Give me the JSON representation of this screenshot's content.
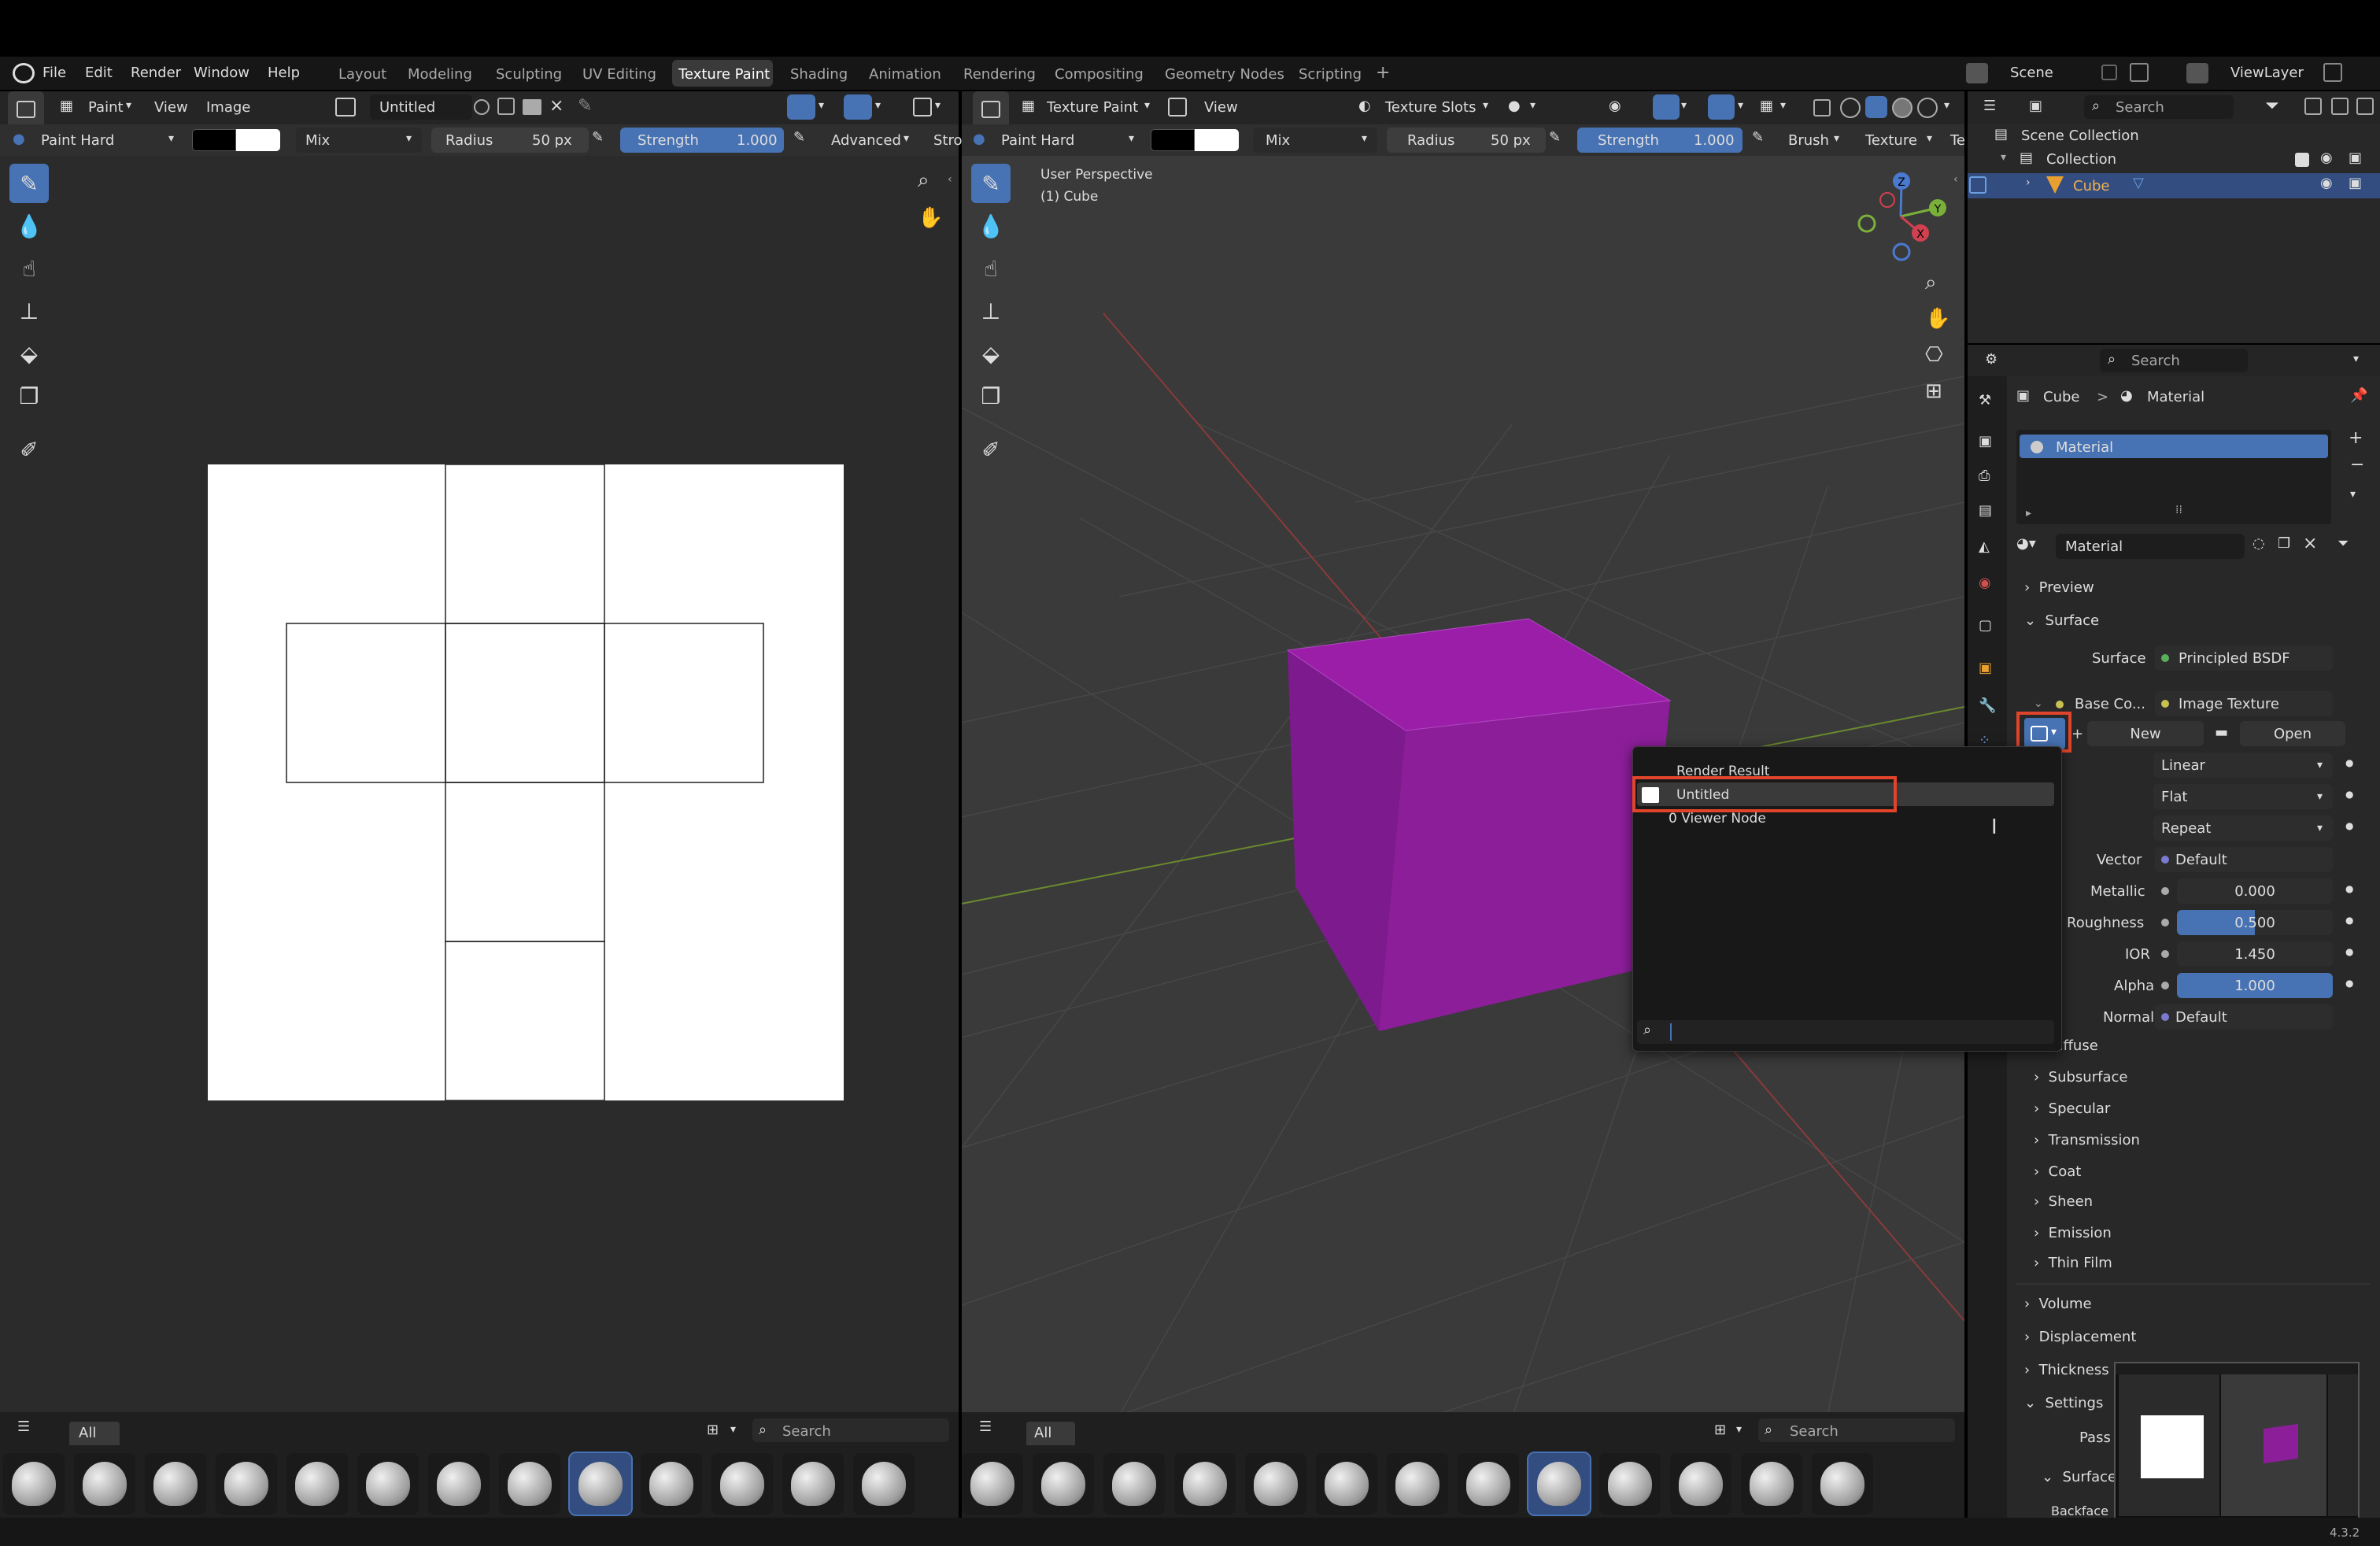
{
  "menu": {
    "items": [
      "File",
      "Edit",
      "Render",
      "Window",
      "Help"
    ],
    "workspaces": [
      "Layout",
      "Modeling",
      "Sculpting",
      "UV Editing",
      "Texture Paint",
      "Shading",
      "Animation",
      "Rendering",
      "Compositing",
      "Geometry Nodes",
      "Scripting"
    ],
    "active_workspace": "Texture Paint",
    "add_tab": "+",
    "scene": "Scene",
    "view_layer": "ViewLayer"
  },
  "image_editor": {
    "mode": "Paint",
    "view": "View",
    "image_menu": "Image",
    "image_name": "Untitled",
    "brush": "Paint Hard",
    "blend": "Mix",
    "radius_label": "Radius",
    "radius_value": "50 px",
    "strength_label": "Strength",
    "strength_value": "1.000",
    "advanced": "Advanced",
    "truncated": "Stro",
    "filter_all": "All",
    "search_placeholder": "Search"
  },
  "viewport": {
    "mode": "Texture Paint",
    "view": "View",
    "texture_slots": "Texture Slots",
    "brush": "Paint Hard",
    "blend": "Mix",
    "radius_label": "Radius",
    "radius_value": "50 px",
    "strength_label": "Strength",
    "strength_value": "1.000",
    "brush_menu": "Brush",
    "texture_menu": "Texture",
    "truncated": "Te",
    "perspective": "User Perspective",
    "object": "(1) Cube",
    "gizmo": {
      "z": "Z",
      "y": "Y",
      "x": "X"
    },
    "filter_all": "All",
    "search_placeholder": "Search"
  },
  "outliner": {
    "search_placeholder": "Search",
    "scene_collection": "Scene Collection",
    "collection": "Collection",
    "cube": "Cube"
  },
  "properties": {
    "search_placeholder": "Search",
    "breadcrumb_object": "Cube",
    "breadcrumb_sep": ">",
    "breadcrumb_material": "Material",
    "slot_name": "Material",
    "material_name": "Material",
    "sections": {
      "preview": "Preview",
      "surface": "Surface",
      "diffuse": "Diffuse",
      "subsurface": "Subsurface",
      "specular": "Specular",
      "transmission": "Transmission",
      "coat": "Coat",
      "sheen": "Sheen",
      "emission": "Emission",
      "thin_film": "Thin Film",
      "volume": "Volume",
      "displacement": "Displacement",
      "thickness": "Thickness",
      "settings": "Settings",
      "pass": "Pass",
      "surface_sub": "Surface",
      "backface": "Backface"
    },
    "surface_label": "Surface",
    "surface_value": "Principled BSDF",
    "base_color_label": "Base Co...",
    "base_color_value": "Image Texture",
    "new_button": "New",
    "open_button": "Open",
    "interpolation": "Linear",
    "projection": "Flat",
    "extension": "Repeat",
    "vector_label": "Vector",
    "vector_value": "Default",
    "metallic_label": "Metallic",
    "metallic_value": "0.000",
    "roughness_label": "Roughness",
    "roughness_value": "0.500",
    "ior_label": "IOR",
    "ior_value": "1.450",
    "alpha_label": "Alpha",
    "alpha_value": "1.000",
    "normal_label": "Normal",
    "normal_value": "Default"
  },
  "image_dropdown": {
    "items": [
      "Render Result",
      "Untitled",
      "0 Viewer Node"
    ],
    "selected": "Untitled"
  },
  "status": {
    "version": "4.3.2"
  },
  "colors": {
    "accent": "#4772b3",
    "highlight_box": "#e0442a",
    "cube": "#8c1e9a"
  }
}
